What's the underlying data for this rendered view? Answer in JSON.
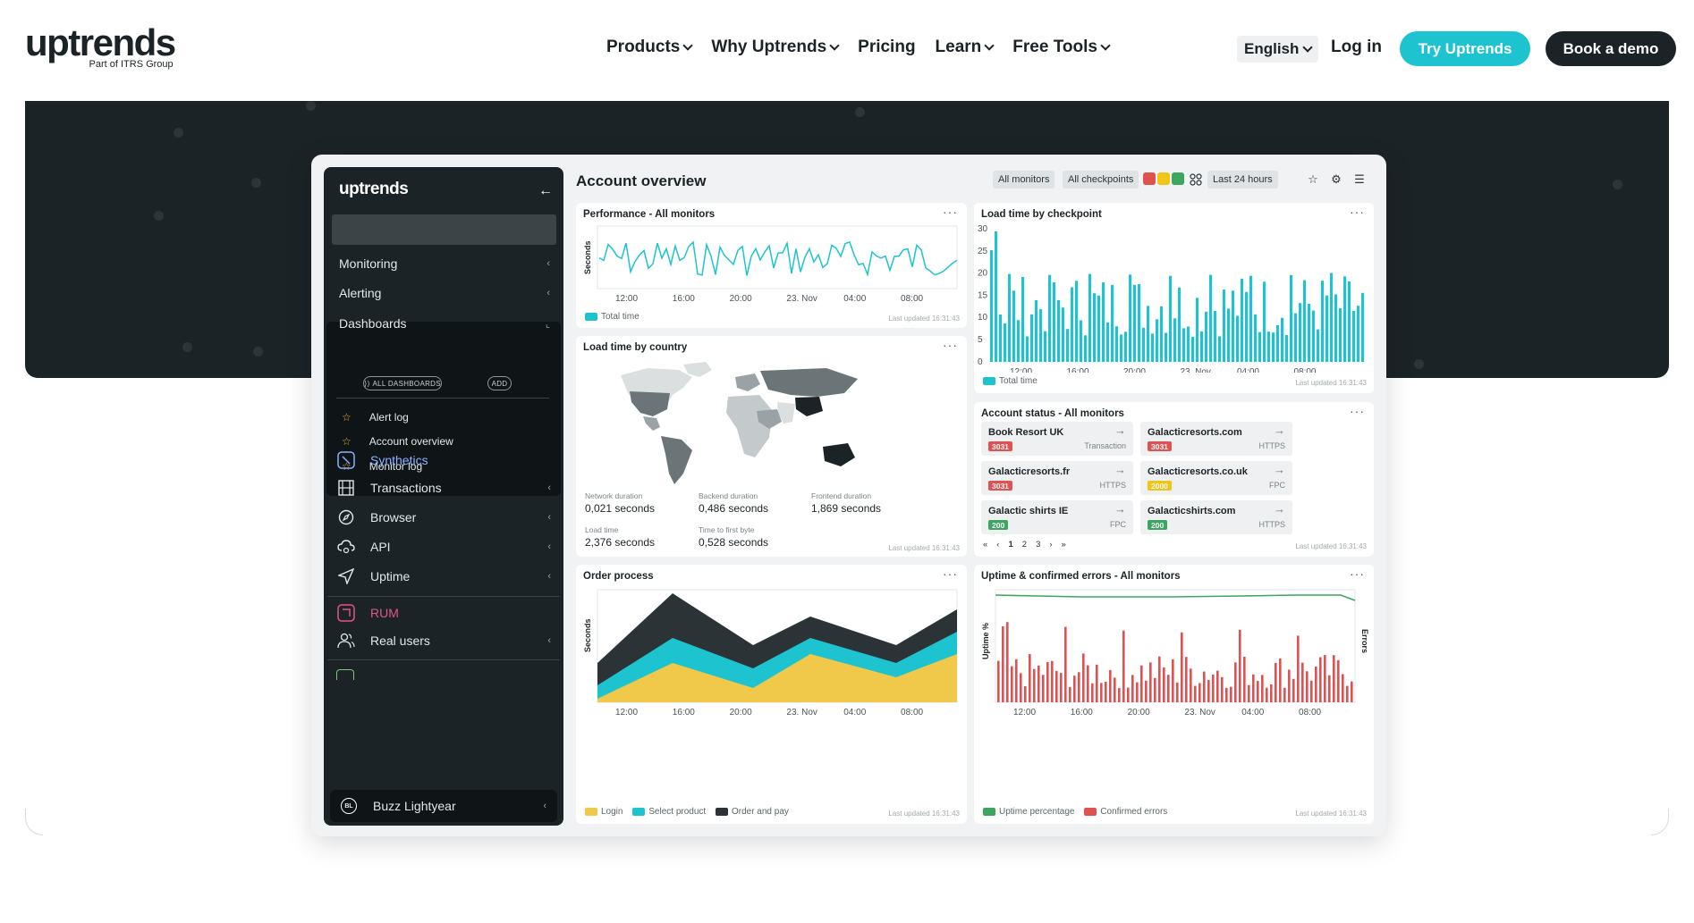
{
  "header": {
    "logo": "uptrends",
    "logo_sub": "Part of ITRS Group",
    "nav": [
      {
        "label": "Products",
        "has_menu": true
      },
      {
        "label": "Why Uptrends",
        "has_menu": true
      },
      {
        "label": "Pricing",
        "has_menu": false
      },
      {
        "label": "Learn",
        "has_menu": true
      },
      {
        "label": "Free Tools",
        "has_menu": true
      }
    ],
    "language": "English",
    "login": "Log in",
    "try_label": "Try Uptrends",
    "demo_label": "Book a demo",
    "colors": {
      "try_button": "#1ec3d0",
      "dark": "#1c2326"
    }
  },
  "app": {
    "sidebar": {
      "logo": "uptrends",
      "menu": [
        {
          "label": "Monitoring"
        },
        {
          "label": "Alerting"
        },
        {
          "label": "Dashboards"
        }
      ],
      "dash_pills": {
        "all": "ALL DASHBOARDS",
        "add": "ADD"
      },
      "favorites": [
        "Alert log",
        "Account overview",
        "Monitor log"
      ],
      "synthetics": {
        "title": "Synthetics",
        "items": [
          "Transactions",
          "Browser",
          "API",
          "Uptime"
        ]
      },
      "rum": {
        "title": "RUM",
        "items": [
          "Real users"
        ]
      },
      "user": {
        "initials": "BL",
        "name": "Buzz Lightyear"
      }
    },
    "toolbar": {
      "title": "Account overview",
      "monitors": "All monitors",
      "checkpoints": "All checkpoints",
      "range": "Last 24 hours",
      "status_colors": [
        "#e05252",
        "#f0c419",
        "#3aa660"
      ]
    },
    "updated_text": "Last updated 16:31:43",
    "time_ticks": [
      "12:00",
      "16:00",
      "20:00",
      "23. Nov",
      "04:00",
      "08:00"
    ],
    "performance": {
      "title": "Performance - All monitors",
      "ylabel": "Seconds",
      "legend": "Total time",
      "color": "#1ec3d0"
    },
    "loadtime": {
      "title": "Load time by checkpoint",
      "legend": "Total time",
      "yticks": [
        "30",
        "25",
        "20",
        "15",
        "10",
        "5",
        "0"
      ],
      "color": "#1ec3d0"
    },
    "country": {
      "title": "Load time by country",
      "metrics": [
        {
          "label": "Network duration",
          "value": "0,021 seconds"
        },
        {
          "label": "Backend duration",
          "value": "0,486 seconds"
        },
        {
          "label": "Frontend duration",
          "value": "1,869 seconds"
        },
        {
          "label": "Load time",
          "value": "2,376 seconds"
        },
        {
          "label": "Time to first byte",
          "value": "0,528 seconds"
        }
      ]
    },
    "status": {
      "title": "Account status - All monitors",
      "tiles": [
        {
          "name": "Book Resort UK",
          "code": "3031",
          "type": "Transaction",
          "color": "#e05252"
        },
        {
          "name": "Galacticresorts.com",
          "code": "3031",
          "type": "HTTPS",
          "color": "#e05252"
        },
        {
          "name": "Galacticresorts.fr",
          "code": "3031",
          "type": "HTTPS",
          "color": "#e05252"
        },
        {
          "name": "Galacticresorts.co.uk",
          "code": "2000",
          "type": "FPC",
          "color": "#f0c419"
        },
        {
          "name": "Galactic shirts IE",
          "code": "200",
          "type": "FPC",
          "color": "#3aa660"
        },
        {
          "name": "Galacticshirts.com",
          "code": "200",
          "type": "HTTPS",
          "color": "#3aa660"
        }
      ],
      "pages": [
        "1",
        "2",
        "3"
      ]
    },
    "order": {
      "title": "Order process",
      "ylabel": "Seconds",
      "legend": [
        {
          "name": "Login",
          "color": "#f0c94a"
        },
        {
          "name": "Select product",
          "color": "#1ec3d0"
        },
        {
          "name": "Order and pay",
          "color": "#2b3336"
        }
      ]
    },
    "uptime": {
      "title": "Uptime & confirmed errors - All monitors",
      "ylabel": "Uptime %",
      "y2label": "Errors",
      "legend": [
        {
          "name": "Uptime percentage",
          "color": "#3aa660"
        },
        {
          "name": "Confirmed errors",
          "color": "#e05252"
        }
      ]
    }
  }
}
